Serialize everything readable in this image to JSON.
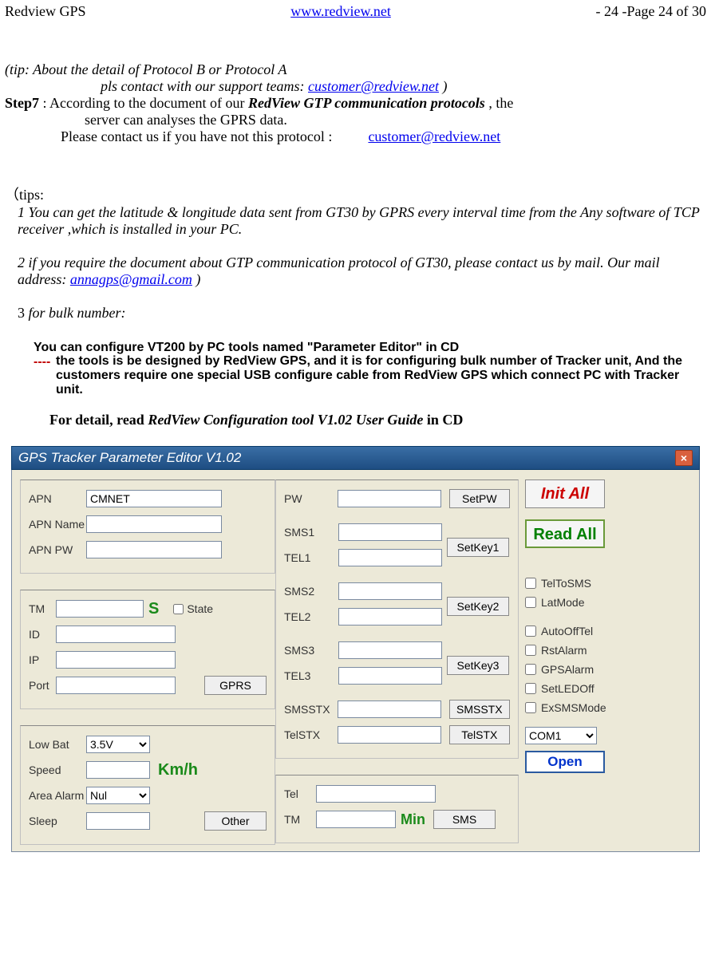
{
  "header": {
    "left": "Redview GPS",
    "center": "www.redview.net",
    "right": "- 24 -Page 24 of 30"
  },
  "text": {
    "tip_line1": "(tip: About the detail of Protocol B or Protocol A",
    "tip_line2_prefix": "pls contact with our support teams: ",
    "tip_email": "customer@redview.net",
    "tip_line2_suffix": " )",
    "step7_label": "Step7",
    "step7_rest1": " : According to the document of our ",
    "step7_bold": "RedView GTP communication protocols",
    "step7_rest2": " , the",
    "step7_line2": "server can analyses the GPRS data.",
    "step7_line3": "Please contact us if you have not this protocol :",
    "step7_email": "customer@redview.net",
    "tips_open": "（tips:",
    "tip1": "1 You can get the latitude & longitude data sent from GT30 by GPRS every interval time from the Any software of TCP receiver ,which is installed in your PC.",
    "tip2_prefix": "2 if you require the document about GTP communication protocol of GT30, please contact us by mail. Our mail address: ",
    "tip2_email": "annagps@gmail.com",
    "tip2_suffix": " )",
    "tip3_num": "3",
    "tip3_rest": " for bulk number:",
    "bulk_line1": "You can configure VT200 by PC tools named \"Parameter Editor\" in CD",
    "bulk_dashes": "----",
    "bulk_line2": "the tools is be designed by RedView GPS, and it is for configuring bulk number of Tracker unit, And the customers require one special USB configure cable from RedView GPS which connect PC with Tracker unit.",
    "detail_prefix": "For detail, read ",
    "detail_italic": "RedView Configuration tool V1.02 User Guide",
    "detail_suffix": " in CD"
  },
  "dialog": {
    "title": "GPS Tracker Parameter Editor V1.02",
    "close": "×",
    "labels": {
      "apn": "APN",
      "apn_name": "APN Name",
      "apn_pw": "APN PW",
      "tm": "TM",
      "id": "ID",
      "ip": "IP",
      "port": "Port",
      "low_bat": "Low Bat",
      "speed": "Speed",
      "area_alarm": "Area Alarm",
      "sleep": "Sleep",
      "pw": "PW",
      "sms1": "SMS1",
      "tel1": "TEL1",
      "sms2": "SMS2",
      "tel2": "TEL2",
      "sms3": "SMS3",
      "tel3": "TEL3",
      "smsstx": "SMSSTX",
      "telstx": "TelSTX",
      "tel": "Tel",
      "tm2": "TM",
      "s_unit": "S",
      "kmh": "Km/h",
      "min": "Min",
      "state": "State"
    },
    "values": {
      "apn": "CMNET",
      "low_bat": "3.5V",
      "area_alarm": "Nul",
      "com": "COM1"
    },
    "buttons": {
      "gprs": "GPRS",
      "other": "Other",
      "setpw": "SetPW",
      "setkey1": "SetKey1",
      "setkey2": "SetKey2",
      "setkey3": "SetKey3",
      "smsstx": "SMSSTX",
      "telstx": "TelSTX",
      "sms": "SMS",
      "init_all": "Init All",
      "read_all": "Read All",
      "open": "Open"
    },
    "checks": {
      "teltosms": "TelToSMS",
      "latmode": "LatMode",
      "autoofftel": "AutoOffTel",
      "rstalarm": "RstAlarm",
      "gpsalarm": "GPSAlarm",
      "setledoff": "SetLEDOff",
      "exsmsmode": "ExSMSMode"
    }
  }
}
